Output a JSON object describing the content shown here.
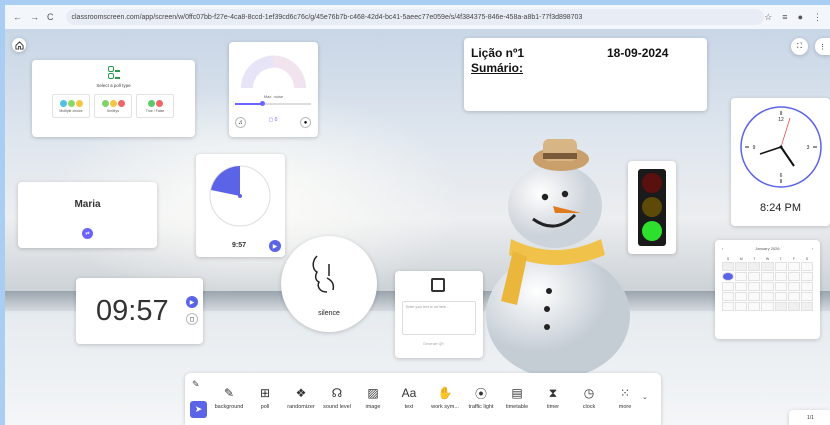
{
  "browser": {
    "url": "classroomscreen.com/app/screen/w/0ffc07bb-f27e-4ca8-8ccd-1ef39cd6c76c/g/45e76b7b-c468-42d4-bc41-5aeec77e059e/s/4f384375-846e-458a-a8b1-77f3d898703"
  },
  "poll": {
    "title": "Select a poll type",
    "options": [
      "Multiple choice",
      "Smileys",
      "True / False"
    ]
  },
  "sound": {
    "label": "Max. noise"
  },
  "name": {
    "value": "Maria"
  },
  "timer": {
    "value": "9:57"
  },
  "clock_digital": {
    "value": "09:57"
  },
  "silence": {
    "label": "silence"
  },
  "qr": {
    "placeholder": "Enter your text or url here...",
    "button": "Generate QR"
  },
  "text": {
    "line1": "Lição nº1",
    "date": "18-09-2024",
    "line2": "Sumário:"
  },
  "analog_clock": {
    "time": "8:24 PM"
  },
  "calendar": {
    "month": "January 2026",
    "weekdays": [
      "S",
      "M",
      "T",
      "W",
      "T",
      "F",
      "S"
    ]
  },
  "page": {
    "indicator": "1/1"
  },
  "toolbar": {
    "items": [
      {
        "label": "background",
        "icon": "background-icon"
      },
      {
        "label": "poll",
        "icon": "poll-icon"
      },
      {
        "label": "randomizer",
        "icon": "randomizer-icon"
      },
      {
        "label": "sound level",
        "icon": "sound-level-icon"
      },
      {
        "label": "image",
        "icon": "image-icon"
      },
      {
        "label": "text",
        "icon": "text-icon"
      },
      {
        "label": "work sym...",
        "icon": "work-symbols-icon"
      },
      {
        "label": "traffic light",
        "icon": "traffic-light-icon"
      },
      {
        "label": "timetable",
        "icon": "timetable-icon"
      },
      {
        "label": "timer",
        "icon": "timer-icon"
      },
      {
        "label": "clock",
        "icon": "clock-icon"
      },
      {
        "label": "more",
        "icon": "more-icon"
      }
    ]
  },
  "colors": {
    "accent": "#6c63ff",
    "traffic_red": "#5b1010",
    "traffic_yellow": "#5e4a08",
    "traffic_green": "#2ee02e"
  }
}
